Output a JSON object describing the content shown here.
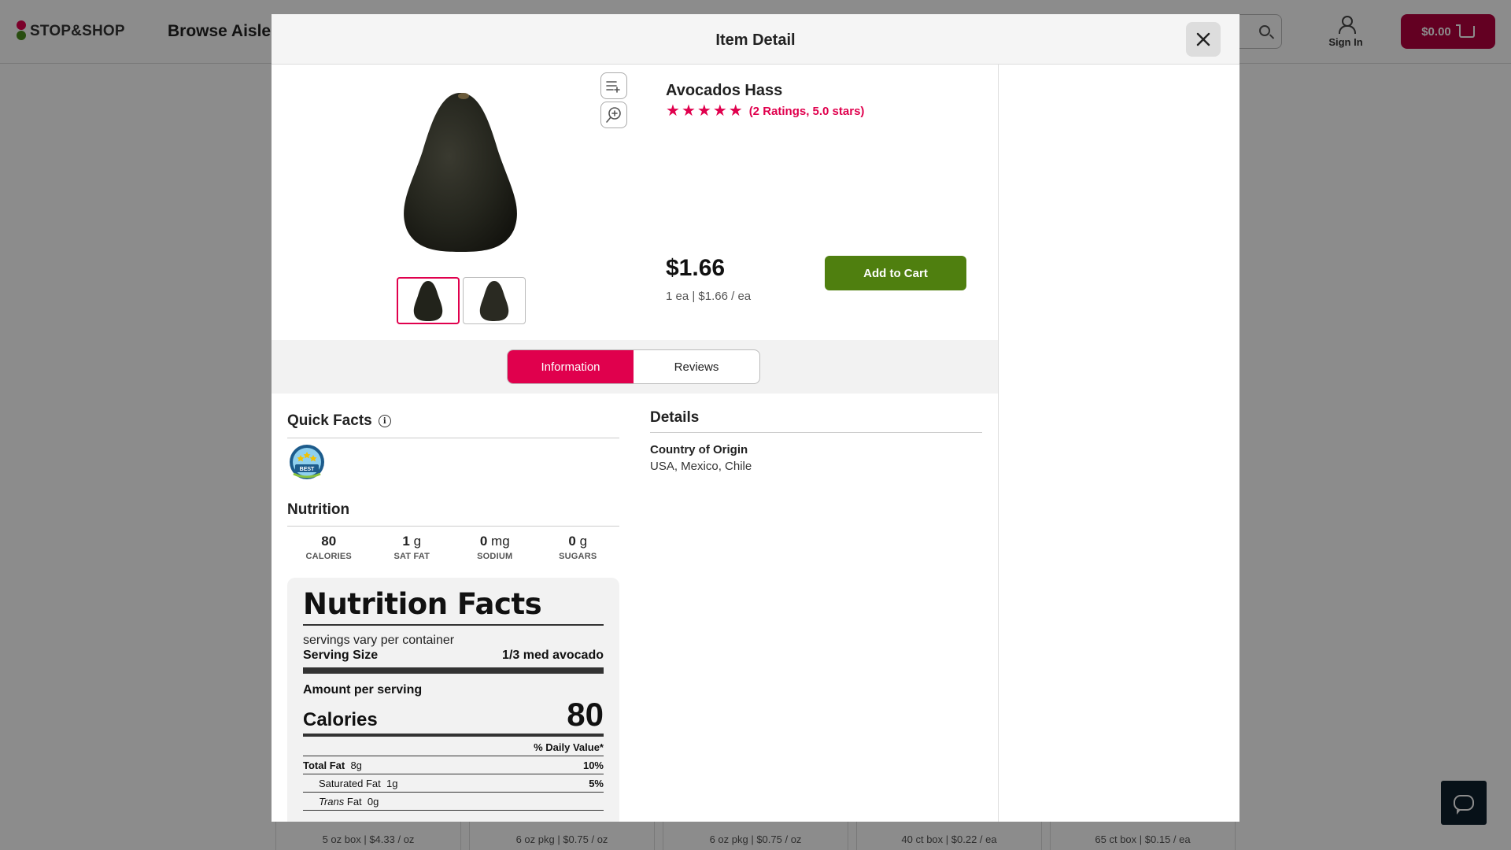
{
  "header": {
    "logo": "STOP&SHOP",
    "browse": "Browse Aisles",
    "signin": "Sign In",
    "cart_total": "$0.00"
  },
  "background_cards": [
    "5 oz box | $4.33 / oz",
    "6 oz pkg | $0.75 / oz",
    "6 oz pkg | $0.75 / oz",
    "40 ct box | $0.22 / ea",
    "65 ct box | $0.15 / ea"
  ],
  "modal": {
    "title": "Item Detail",
    "close_icon": "close-icon"
  },
  "product": {
    "name": "Avocados Hass",
    "rating_stars": 5,
    "rating_text": "(2 Ratings, 5.0 stars)",
    "price": "$1.66",
    "unit_price": "1 ea | $1.66 / ea",
    "add_to_cart": "Add to Cart",
    "thumbnails": 2,
    "selected_thumbnail": 1
  },
  "tabs": [
    {
      "label": "Information",
      "active": true
    },
    {
      "label": "Reviews",
      "active": false
    }
  ],
  "quick_facts": {
    "title": "Quick Facts",
    "badge_text": "BEST"
  },
  "nutrition": {
    "title": "Nutrition",
    "summary": [
      {
        "value": "80",
        "unit": "",
        "label": "CALORIES"
      },
      {
        "value": "1",
        "unit": "g",
        "label": "SAT FAT"
      },
      {
        "value": "0",
        "unit": "mg",
        "label": "SODIUM"
      },
      {
        "value": "0",
        "unit": "g",
        "label": "SUGARS"
      }
    ],
    "facts": {
      "title": "Nutrition Facts",
      "servings": "servings vary per container",
      "serving_size_label": "Serving Size",
      "serving_size_value": "1/3 med avocado",
      "amount_per_serving": "Amount per serving",
      "calories_label": "Calories",
      "calories_value": "80",
      "daily_value_header": "% Daily Value*",
      "rows": [
        {
          "name": "Total Fat",
          "amount": "8g",
          "dv": "10%"
        },
        {
          "name": "Saturated Fat",
          "amount": "1g",
          "dv": "5%"
        },
        {
          "name": "Trans",
          "name_suffix": "Fat",
          "amount": "0g",
          "dv": ""
        }
      ]
    }
  },
  "details": {
    "title": "Details",
    "country_label": "Country of Origin",
    "country_value": "USA, Mexico, Chile"
  },
  "colors": {
    "brand": "#e0004d",
    "cart": "#b5003f",
    "add_to_cart": "#4f7f0f"
  }
}
